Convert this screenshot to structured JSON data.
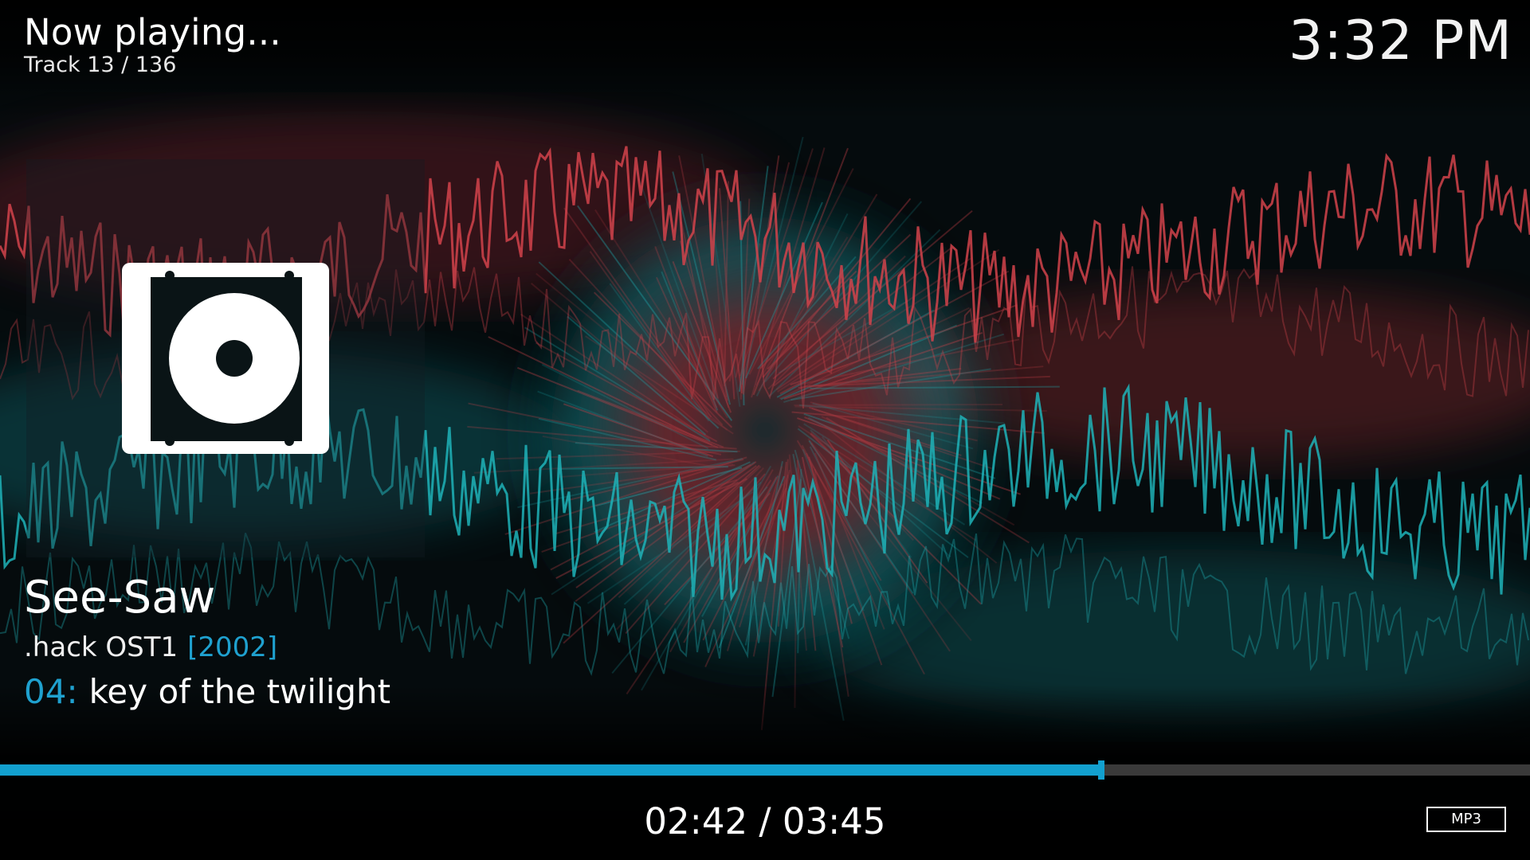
{
  "header": {
    "title": "Now playing...",
    "track_position": "Track 13 / 136",
    "clock": "3:32 PM"
  },
  "artwork": {
    "icon": "disc-icon"
  },
  "now_playing": {
    "title": "See-Saw",
    "album": ".hack OST1",
    "year": "[2002]",
    "track_number": "04:",
    "track_name": "key of the twilight"
  },
  "playback": {
    "time": "02:42 / 03:45",
    "progress_fraction": 0.72,
    "codec": "MP3"
  },
  "colors": {
    "accent": "#12a0cf",
    "wave_red": "#d2434b",
    "wave_teal": "#1fb3b8"
  }
}
